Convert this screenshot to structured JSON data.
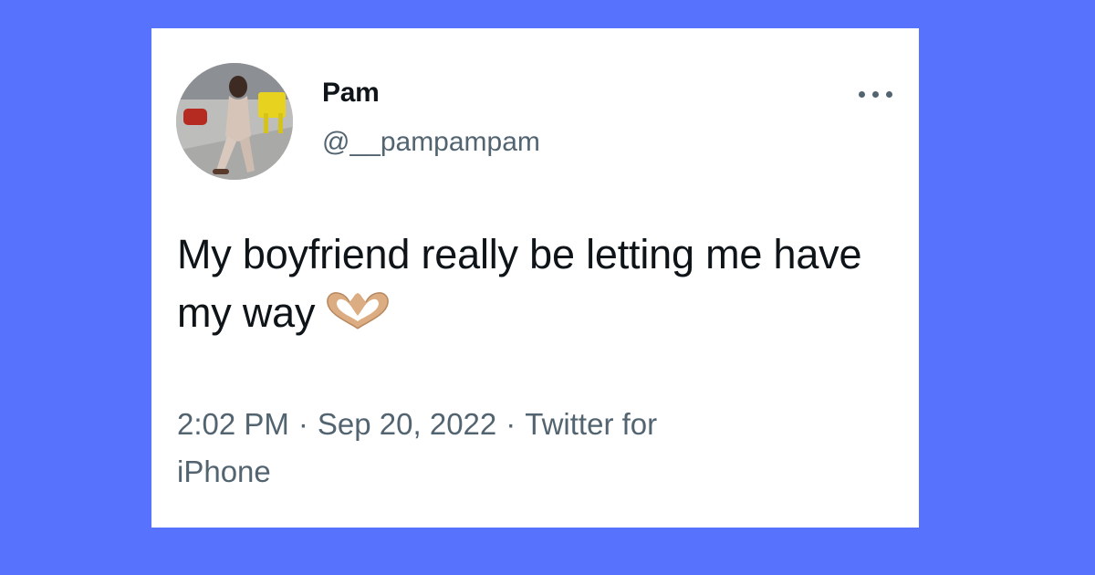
{
  "tweet": {
    "author_name": "Pam",
    "handle": "@__pampampam",
    "text": "My boyfriend really be letting me have my way",
    "emoji_icon": "heart-hands-icon",
    "time": "2:02 PM",
    "separator": "·",
    "date": "Sep 20, 2022",
    "source_line1": "Twitter for",
    "source_line2": "iPhone",
    "more_icon": "more-horizontal-icon"
  },
  "colors": {
    "background": "#5773fd",
    "card": "#ffffff",
    "text_primary": "#0f1419",
    "text_secondary": "#536471"
  }
}
